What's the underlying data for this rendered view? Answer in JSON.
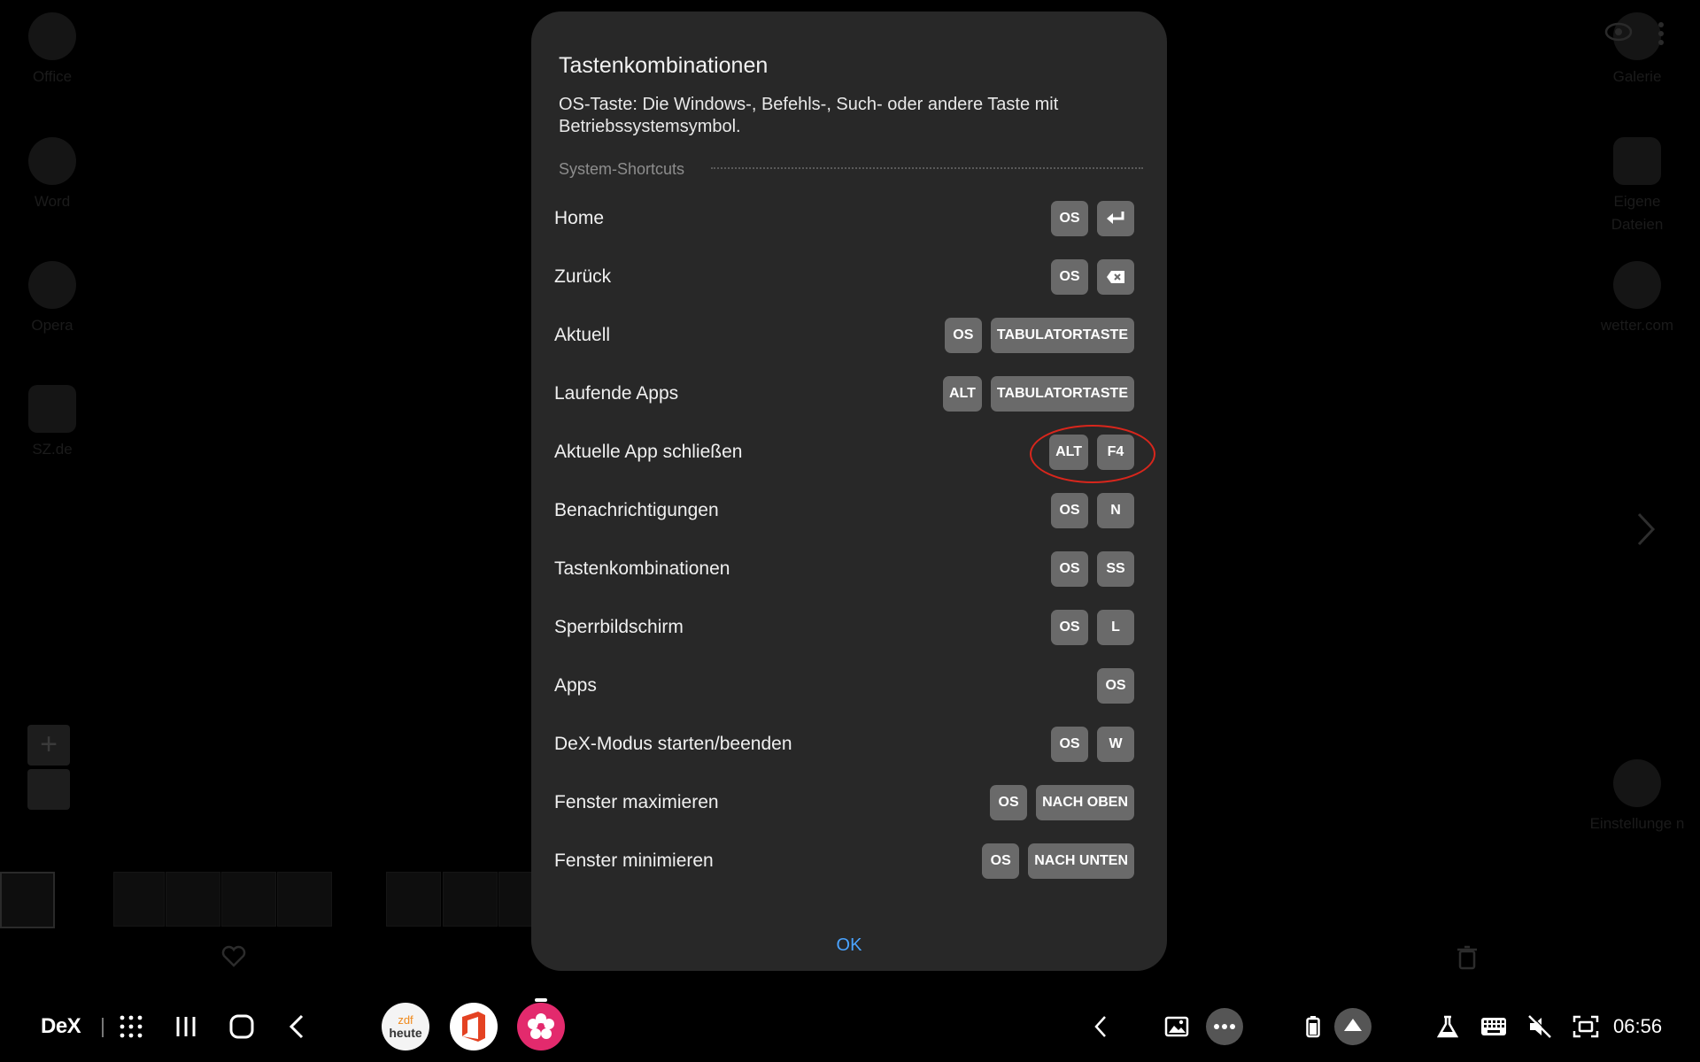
{
  "desktop": {
    "left_icons": [
      {
        "label": "Office",
        "icon": "office-icon"
      },
      {
        "label": "Word",
        "icon": "word-icon"
      },
      {
        "label": "Opera",
        "icon": "opera-icon"
      },
      {
        "label": "SZ.de",
        "icon": "sz-icon"
      }
    ],
    "right_icons": [
      {
        "label": "Galerie",
        "icon": "gallery-icon"
      },
      {
        "label": "Eigene Dateien",
        "icon": "files-icon"
      },
      {
        "label": "wetter.com",
        "icon": "weather-icon"
      },
      {
        "label": "Einstellunge n",
        "icon": "settings-icon"
      }
    ]
  },
  "dialog": {
    "title": "Tastenkombinationen",
    "description": "OS-Taste: Die Windows-, Befehls-, Such- oder andere Taste mit Betriebssystemsymbol.",
    "section": "System-Shortcuts",
    "shortcuts": [
      {
        "label": "Home",
        "keys": [
          "OS",
          "enter-key-icon"
        ]
      },
      {
        "label": "Zurück",
        "keys": [
          "OS",
          "backspace-key-icon"
        ]
      },
      {
        "label": "Aktuell",
        "keys": [
          "OS",
          "TABULATORTASTE"
        ]
      },
      {
        "label": "Laufende Apps",
        "keys": [
          "ALT",
          "TABULATORTASTE"
        ]
      },
      {
        "label": "Aktuelle App schließen",
        "keys": [
          "ALT",
          "F4"
        ]
      },
      {
        "label": "Benachrichtigungen",
        "keys": [
          "OS",
          "N"
        ]
      },
      {
        "label": "Tastenkombinationen",
        "keys": [
          "OS",
          "SS"
        ]
      },
      {
        "label": "Sperrbildschirm",
        "keys": [
          "OS",
          "L"
        ]
      },
      {
        "label": "Apps",
        "keys": [
          "OS"
        ]
      },
      {
        "label": "DeX-Modus starten/beenden",
        "keys": [
          "OS",
          "W"
        ]
      },
      {
        "label": "Fenster maximieren",
        "keys": [
          "OS",
          "NACH OBEN"
        ]
      },
      {
        "label": "Fenster minimieren",
        "keys": [
          "OS",
          "NACH UNTEN"
        ]
      }
    ],
    "ok_label": "OK",
    "highlight_color": "#d8261c"
  },
  "taskbar": {
    "dex_label": "DeX",
    "pinned_apps": [
      {
        "name": "zdf heute",
        "line1": "zdf",
        "line2": "heute"
      },
      {
        "name": "Office"
      },
      {
        "name": "Blossom"
      }
    ],
    "clock": "06:56"
  },
  "colors": {
    "dialog_bg": "#282828",
    "key_bg": "#6a6a6a",
    "ok_blue": "#4aa3ff"
  }
}
